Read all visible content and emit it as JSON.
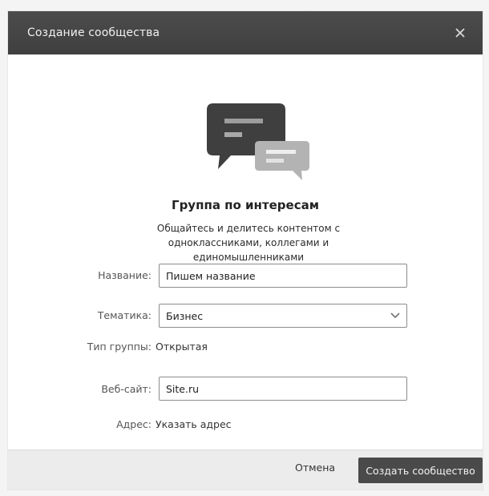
{
  "modal": {
    "title": "Создание сообщества",
    "close_icon": "close-icon"
  },
  "group": {
    "icon": "chat-bubbles-icon",
    "title": "Группа по интересам",
    "description": "Общайтесь и делитесь контентом с одноклассниками, коллегами и единомышленниками"
  },
  "form": {
    "name": {
      "label": "Название:",
      "value": "Пишем название"
    },
    "topic": {
      "label": "Тематика:",
      "value": "Бизнес",
      "icon": "chevron-down-icon"
    },
    "group_type": {
      "label": "Тип группы:",
      "value": "Открытая"
    },
    "website": {
      "label": "Веб-сайт:",
      "value": "Site.ru"
    },
    "address": {
      "label": "Адрес:",
      "value": "Указать адрес"
    }
  },
  "footer": {
    "cancel_label": "Отмена",
    "create_label": "Создать сообщество"
  },
  "colors": {
    "header_bg": "#444444",
    "primary_button": "#4a4a4a",
    "footer_bg": "#ececec"
  }
}
